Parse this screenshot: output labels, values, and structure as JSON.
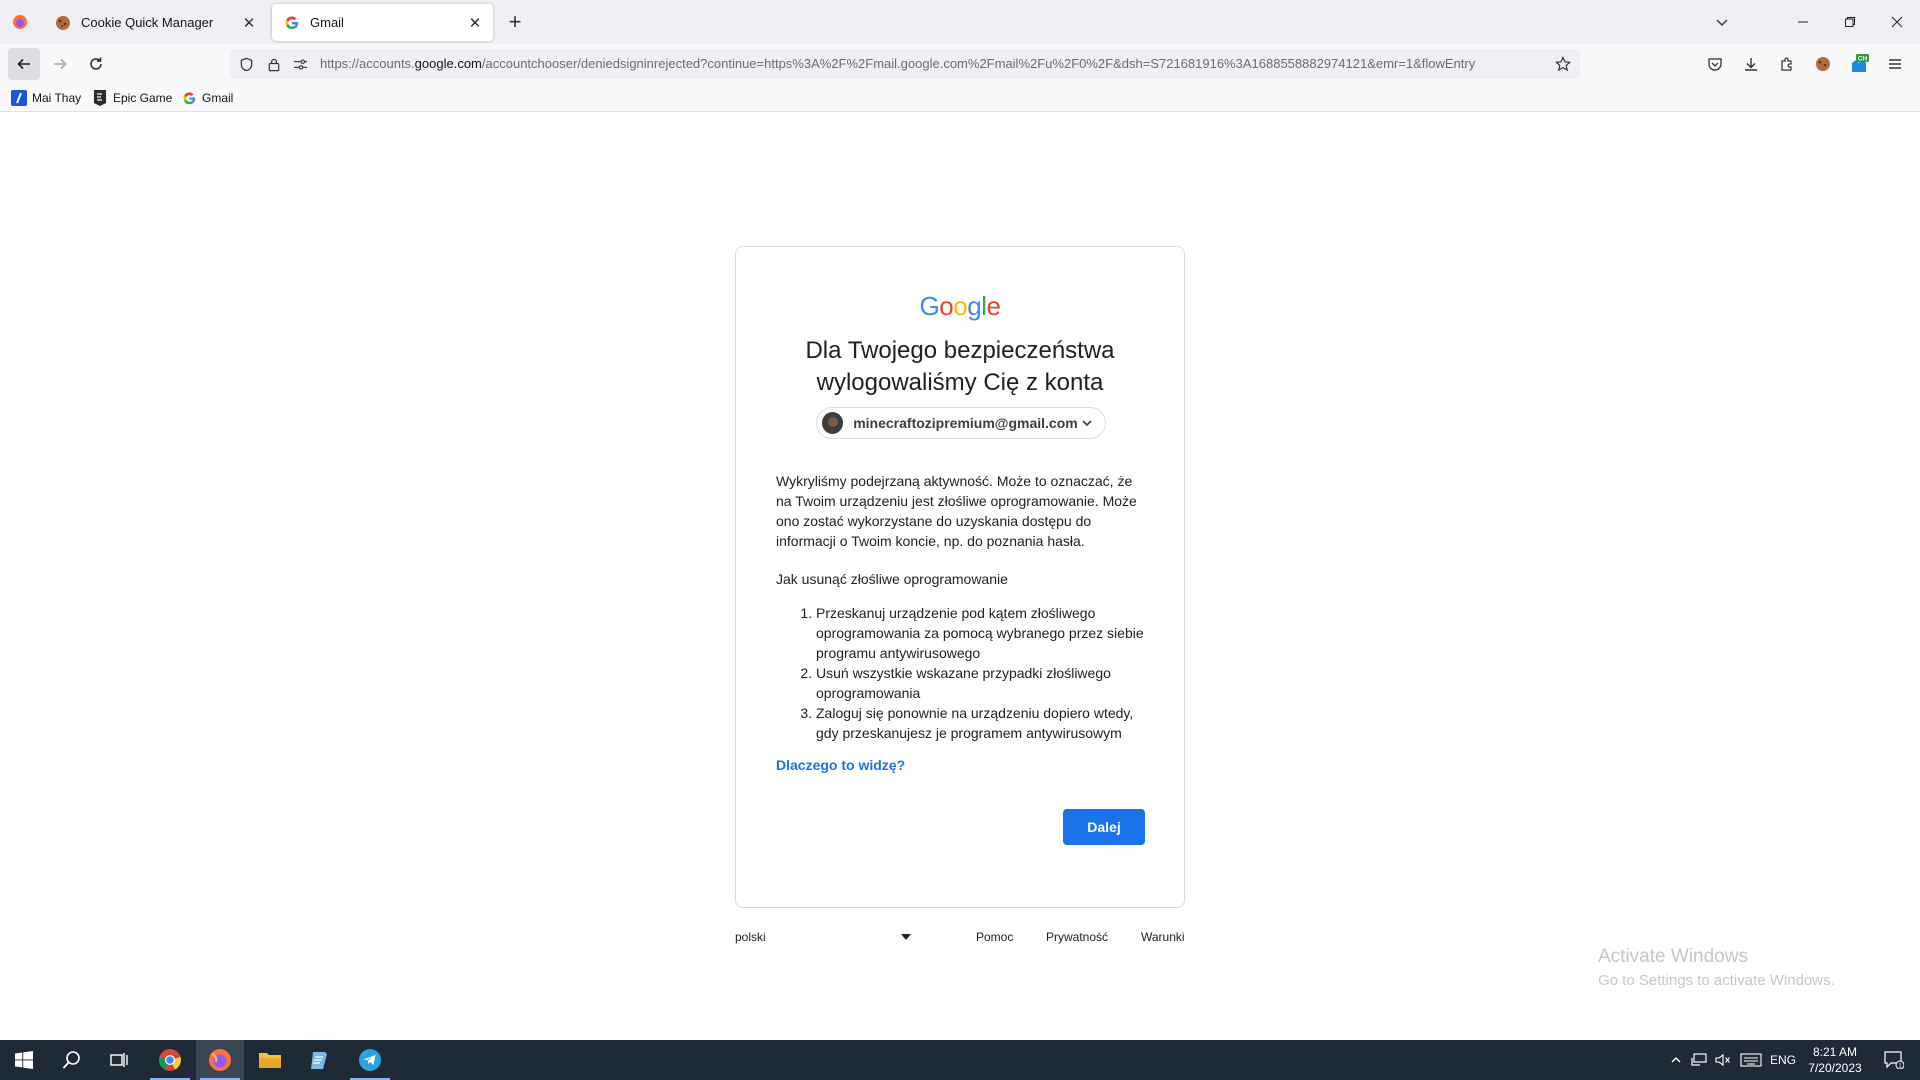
{
  "browser": {
    "tabs": [
      {
        "title": "Cookie Quick Manager",
        "active": false
      },
      {
        "title": "Gmail",
        "active": true
      }
    ],
    "url": {
      "prefix": "https://accounts.",
      "domain": "google.com",
      "path": "/accountchooser/deniedsigninrejected?continue=https%3A%2F%2Fmail.google.com%2Fmail%2Fu%2F0%2F&dsh=S721681916%3A1688558882974121&emr=1&flowEntry"
    },
    "bookmarks": [
      {
        "label": "Mai Thay",
        "icon": "bookmark-mai-thay-icon"
      },
      {
        "label": "Epic Game",
        "icon": "epic-games-icon"
      },
      {
        "label": "Gmail",
        "icon": "google-g-icon"
      }
    ],
    "extension_badge": "CH"
  },
  "page": {
    "logo_letters": [
      {
        "ch": "G",
        "color": "#4285F4"
      },
      {
        "ch": "o",
        "color": "#EA4335"
      },
      {
        "ch": "o",
        "color": "#FBBC05"
      },
      {
        "ch": "g",
        "color": "#4285F4"
      },
      {
        "ch": "l",
        "color": "#34A853"
      },
      {
        "ch": "e",
        "color": "#EA4335"
      }
    ],
    "heading": "Dla Twojego bezpieczeństwa wylogowaliśmy Cię z konta",
    "account_email": "minecraftozipremium@gmail.com",
    "paragraph": "Wykryliśmy podejrzaną aktywność. Może to oznaczać, że na Twoim urządzeniu jest złośliwe oprogramowanie. Może ono zostać wykorzystane do uzyskania dostępu do informacji o Twoim koncie, np. do poznania hasła.",
    "subheading": "Jak usunąć złośliwe oprogramowanie",
    "steps": [
      "Przeskanuj urządzenie pod kątem złośliwego oprogramowania za pomocą wybranego przez siebie programu antywirusowego",
      "Usuń wszystkie wskazane przypadki złośliwego oprogramowania",
      "Zaloguj się ponownie na urządzeniu dopiero wtedy, gdy przeskanujesz je programem antywirusowym"
    ],
    "why_link": "Dlaczego to widzę?",
    "next_button": "Dalej",
    "accent": "#1a73e8"
  },
  "footer": {
    "language": "polski",
    "links": [
      "Pomoc",
      "Prywatność",
      "Warunki"
    ]
  },
  "watermark": {
    "line1": "Activate Windows",
    "line2": "Go to Settings to activate Windows."
  },
  "taskbar": {
    "language": "ENG",
    "time": "8:21 AM",
    "date": "7/20/2023",
    "notification_count": "1"
  }
}
